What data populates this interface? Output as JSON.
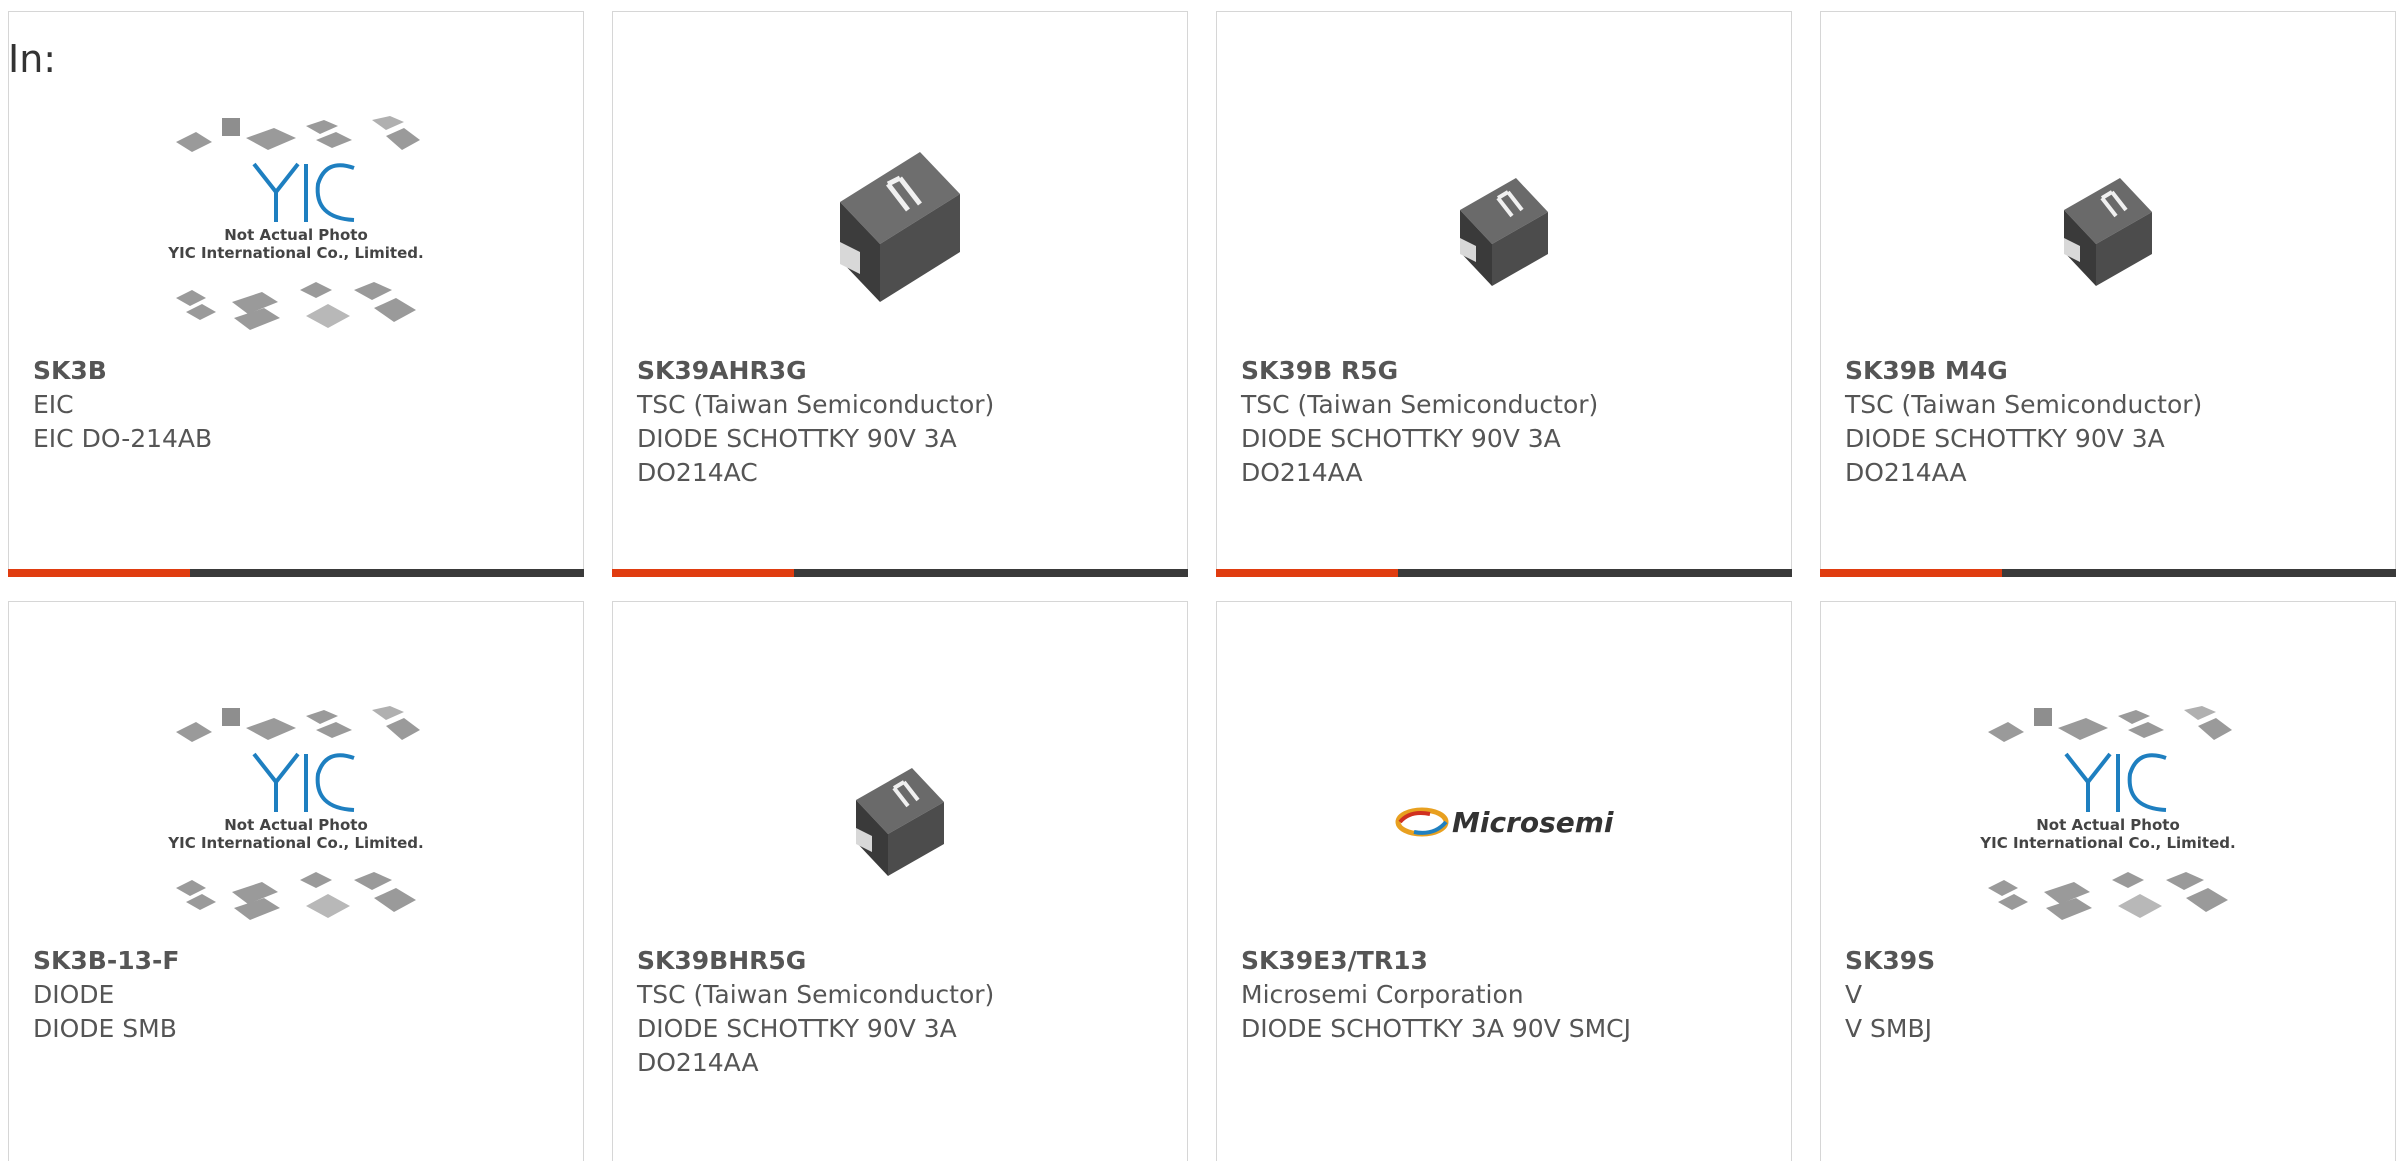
{
  "heading": "In:",
  "products": [
    {
      "part": "SK3B",
      "maker": "EIC",
      "lines": [
        "EIC DO-214AB"
      ],
      "image": "yic-placeholder"
    },
    {
      "part": "SK39AHR3G",
      "maker": "TSC (Taiwan Semiconductor)",
      "lines": [
        "DIODE SCHOTTKY 90V 3A",
        "DO214AC"
      ],
      "image": "smd-diode-large"
    },
    {
      "part": "SK39B R5G",
      "maker": "TSC (Taiwan Semiconductor)",
      "lines": [
        "DIODE SCHOTTKY 90V 3A",
        "DO214AA"
      ],
      "image": "smd-diode-small"
    },
    {
      "part": "SK39B M4G",
      "maker": "TSC (Taiwan Semiconductor)",
      "lines": [
        "DIODE SCHOTTKY 90V 3A",
        "DO214AA"
      ],
      "image": "smd-diode-small"
    },
    {
      "part": "SK3B-13-F",
      "maker": "DIODE",
      "lines": [
        "DIODE SMB"
      ],
      "image": "yic-placeholder"
    },
    {
      "part": "SK39BHR5G",
      "maker": "TSC (Taiwan Semiconductor)",
      "lines": [
        "DIODE SCHOTTKY 90V 3A",
        "DO214AA"
      ],
      "image": "smd-diode-small"
    },
    {
      "part": "SK39E3/TR13",
      "maker": "Microsemi Corporation",
      "lines": [
        "DIODE SCHOTTKY 3A 90V SMCJ"
      ],
      "image": "microsemi-logo"
    },
    {
      "part": "SK39S",
      "maker": "V",
      "lines": [
        "V SMBJ"
      ],
      "image": "yic-placeholder"
    }
  ],
  "placeholder": {
    "brand": "YIC",
    "line1": "Not Actual Photo",
    "line2": "YIC International Co., Limited."
  },
  "microsemi_logo_text": "Microsemi",
  "colors": {
    "accent": "#e03c10",
    "bar": "#3a3a3a",
    "text": "#555555"
  }
}
